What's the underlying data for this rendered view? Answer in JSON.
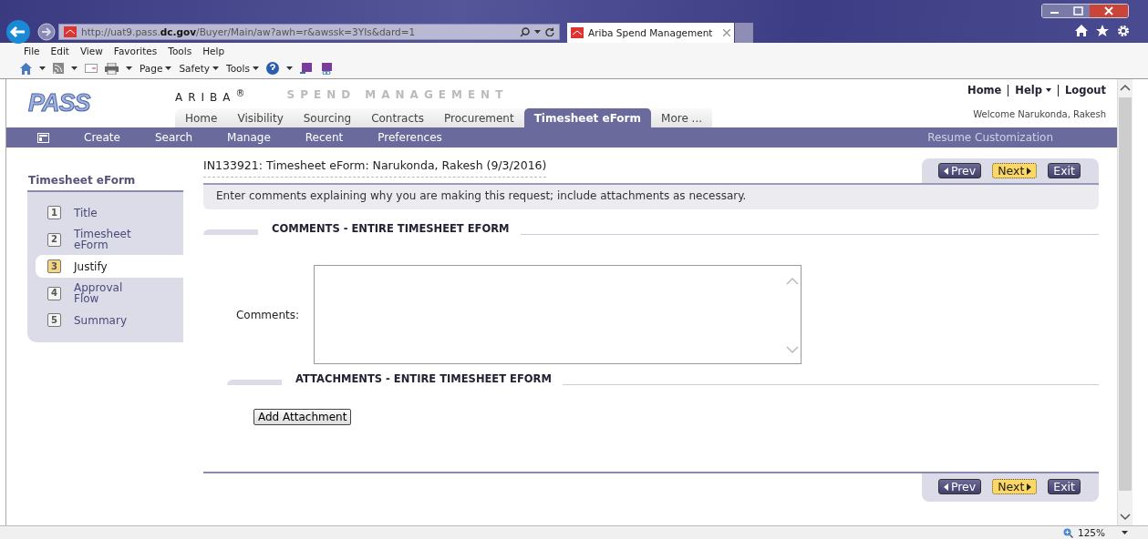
{
  "browser": {
    "address": "http://uat9.pass.**dc.gov**/Buyer/Main/aw?awh=r&awssk=3YIs&dard=1",
    "tabs": [
      {
        "label": "Ariba Spend Management",
        "selected": true
      }
    ],
    "menu": [
      "File",
      "Edit",
      "View",
      "Favorites",
      "Tools",
      "Help"
    ],
    "commands": [
      "Page",
      "Safety",
      "Tools"
    ],
    "zoom": "125%"
  },
  "header": {
    "logo": "PASS",
    "brand": "ARIBA$^{®}$",
    "product": "SPEND MANAGEMENT",
    "links": [
      "Home",
      "Help",
      "Logout"
    ],
    "welcome": "Welcome Narukonda, Rakesh",
    "tabs": [
      {
        "label": "Home",
        "selected": false
      },
      {
        "label": "Visibility",
        "selected": false
      },
      {
        "label": "Sourcing",
        "selected": false
      },
      {
        "label": "Contracts",
        "selected": false
      },
      {
        "label": "Procurement",
        "selected": false
      },
      {
        "label": "Timesheet eForm",
        "selected": true
      },
      {
        "label": "More ...",
        "selected": false
      }
    ]
  },
  "nav": {
    "items": [
      "Create",
      "Search",
      "Manage",
      "Recent",
      "Preferences"
    ],
    "right": "Resume Customization"
  },
  "sidebar": {
    "title": "Timesheet eForm",
    "steps": [
      {
        "number": "1",
        "label": "Title",
        "selected": false
      },
      {
        "number": "2",
        "label": "Timesheet eForm",
        "selected": false
      },
      {
        "number": "3",
        "label": "Justify",
        "selected": true
      },
      {
        "number": "4",
        "label": "Approval Flow",
        "selected": false
      },
      {
        "number": "5",
        "label": "Summary",
        "selected": false
      }
    ]
  },
  "main": {
    "title": "IN133921: Timesheet eForm: Narukonda, Rakesh (9/3/2016)",
    "instruction": "Enter comments explaining why you are making this request; include attachments as necessary.",
    "comments_section": "COMMENTS - ENTIRE TIMESHEET EFORM",
    "comments_label": "Comments:",
    "attachments_section": "ATTACHMENTS - ENTIRE TIMESHEET EFORM",
    "add_attachment": "Add Attachment",
    "top_nav_buttons": [
      {
        "label": "Prev",
        "kind": "prev"
      },
      {
        "label": "Next",
        "kind": "next"
      },
      {
        "label": "Exit",
        "kind": "exit"
      }
    ],
    "bottom_nav_buttons": [
      {
        "label": "Prev",
        "kind": "prev"
      },
      {
        "label": "Next",
        "kind": "next"
      },
      {
        "label": "Exit",
        "kind": "exit"
      }
    ]
  }
}
